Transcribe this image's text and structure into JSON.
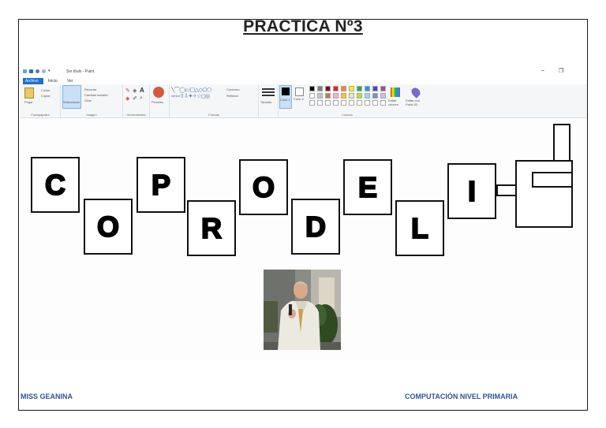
{
  "document": {
    "title": "PRACTICA Nº3",
    "footer_left": "MISS GEANINA",
    "footer_right": "COMPUTACIÓN NIVEL PRIMARIA"
  },
  "paint": {
    "window_title": "Sin título - Paint",
    "menu": [
      "Archivo",
      "Inicio",
      "Ver"
    ],
    "ribbon": {
      "clipboard": {
        "label": "Portapapeles",
        "paste": "Pegar",
        "cut": "Cortar",
        "copy": "Copiar"
      },
      "image": {
        "label": "Imagen",
        "select": "Seleccionar",
        "crop": "Recortar",
        "resize": "Cambiar tamaño",
        "rotate": "Girar"
      },
      "tools": {
        "label": "Herramientas"
      },
      "brushes": {
        "label": "Pinceles"
      },
      "shapes": {
        "label": "Formas",
        "outline": "Contorno",
        "fill": "Rellenar"
      },
      "size": {
        "label": "Tamaño"
      },
      "color1": "Color 1",
      "color2": "Color 2",
      "colors": {
        "label": "Colores",
        "edit": "Editar colores",
        "paint3d": "Editar con Paint 3D"
      }
    },
    "palette": [
      "#000000",
      "#7f7f7f",
      "#880015",
      "#ed1c24",
      "#ff7f27",
      "#fff200",
      "#22b14c",
      "#00a2e8",
      "#3f48cc",
      "#a349a4",
      "#ffffff",
      "#c3c3c3",
      "#b97a57",
      "#ffaec9",
      "#ffc90e",
      "#efe4b0",
      "#b5e61d",
      "#99d9ea",
      "#7092be",
      "#c8bfe7"
    ],
    "letters": [
      "C",
      "O",
      "P",
      "R",
      "O",
      "D",
      "E",
      "L",
      "I"
    ]
  }
}
